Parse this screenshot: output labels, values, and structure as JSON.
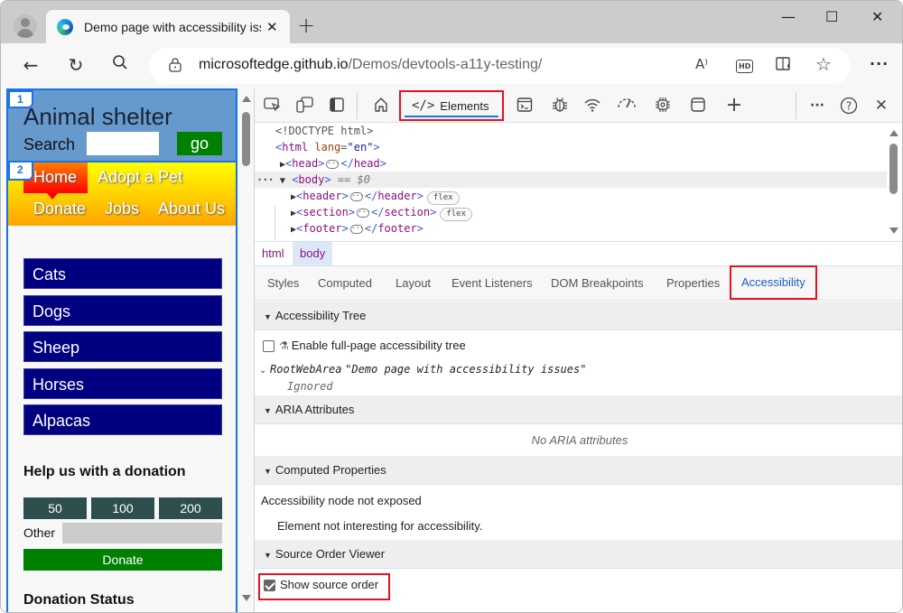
{
  "browser": {
    "tab_title": "Demo page with accessibility issues",
    "new_tab_label": "+",
    "window_controls": {
      "minimize": "—",
      "maximize": "☐",
      "close": "✕"
    },
    "url_host": "microsoftedge.github.io",
    "url_path": "/Demos/devtools-a11y-testing/",
    "nav": {
      "back": "←",
      "refresh": "↻",
      "search": "⌕"
    },
    "omni_icons": {
      "read_aloud": "A⁾",
      "hd": "HD",
      "immersive_reader": "▯",
      "favorite": "☆"
    },
    "more_label": "···"
  },
  "demo_page": {
    "badges": [
      "1",
      "2"
    ],
    "title": "Animal shelter",
    "search_label": "Search",
    "search_value": "",
    "go_label": "go",
    "nav_links": [
      "Home",
      "Adopt a Pet",
      "Donate",
      "Jobs",
      "About Us"
    ],
    "animals": [
      "Cats",
      "Dogs",
      "Sheep",
      "Horses",
      "Alpacas"
    ],
    "donation_heading": "Help us with a donation",
    "amounts": [
      "50",
      "100",
      "200"
    ],
    "other_label": "Other",
    "other_value": "",
    "donate_label": "Donate",
    "status_heading": "Donation Status"
  },
  "devtools": {
    "elements_tab_icon": "</>",
    "elements_tab_label": "Elements",
    "toolbar_icons": [
      "inspect-icon",
      "device-emulation-icon",
      "dock-icon",
      "welcome-home-icon",
      "console-icon",
      "sources-bug-icon",
      "network-wifi-icon",
      "performance-gauge-icon",
      "memory-chip-icon",
      "application-window-icon",
      "more-tools-plus-icon"
    ],
    "more_label": "···",
    "help_label": "?",
    "close_label": "✕",
    "dom": {
      "doctype": "<!DOCTYPE html>",
      "html_tag": "html",
      "html_attr_name": "lang",
      "html_attr_value": "\"en\"",
      "head_tag": "head",
      "body_tag": "body",
      "body_suffix": "== $0",
      "children": [
        {
          "tag": "header",
          "pill": "flex"
        },
        {
          "tag": "section",
          "pill": "flex"
        },
        {
          "tag": "footer",
          "pill": ""
        }
      ],
      "ellipsis": "···"
    },
    "breadcrumbs": [
      "html",
      "body"
    ],
    "subtabs": [
      "Styles",
      "Computed",
      "Layout",
      "Event Listeners",
      "DOM Breakpoints",
      "Properties",
      "Accessibility"
    ],
    "active_subtab": "Accessibility",
    "accessibility": {
      "tree_heading": "Accessibility Tree",
      "enable_full_tree_label": "Enable full-page accessibility tree",
      "enable_full_tree_checked": false,
      "root_role": "RootWebArea",
      "root_name": "\"Demo page with accessibility issues\"",
      "root_status": "Ignored",
      "aria_heading": "ARIA Attributes",
      "aria_empty": "No ARIA attributes",
      "computed_heading": "Computed Properties",
      "node_not_exposed": "Accessibility node not exposed",
      "not_interesting": "Element not interesting for accessibility.",
      "source_order_heading": "Source Order Viewer",
      "show_source_order_label": "Show source order",
      "show_source_order_checked": true
    }
  },
  "colors": {
    "highlight_box": "#e81123",
    "devtools_accent": "#1a73e8",
    "header_bg": "#6699cc",
    "animal_btn": "#000080",
    "go_btn": "#008000",
    "amount_btn": "#2f4f4f"
  }
}
